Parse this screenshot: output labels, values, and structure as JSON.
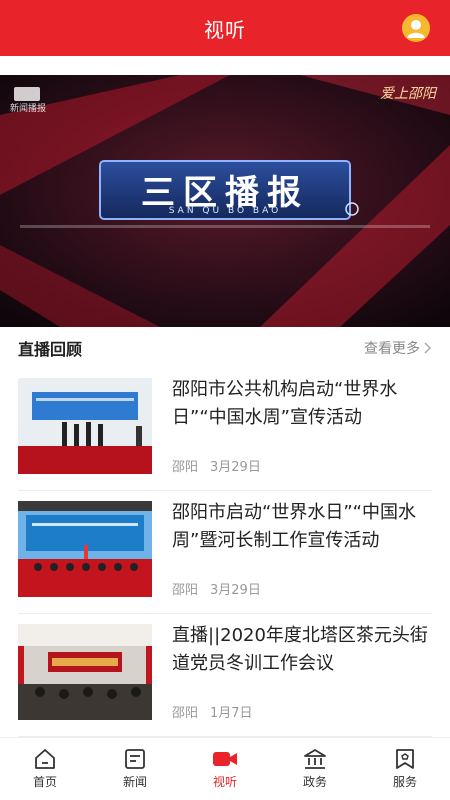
{
  "header": {
    "title": "视听"
  },
  "hero": {
    "title": "三区播报",
    "subtitle": "SAN QU BO BAO",
    "brand_right": "爱上邵阳",
    "brand_left": "新闻播报"
  },
  "section": {
    "title": "直播回顾",
    "more": "查看更多"
  },
  "items": [
    {
      "title": "邵阳市公共机构启动“世界水日”“中国水周”宣传活动",
      "source": "邵阳",
      "date": "3月29日"
    },
    {
      "title": "邵阳市启动“世界水日”“中国水周”暨河长制工作宣传活动",
      "source": "邵阳",
      "date": "3月29日"
    },
    {
      "title": "直播||2020年度北塔区茶元头街道党员冬训工作会议",
      "source": "邵阳",
      "date": "1月7日"
    }
  ],
  "tabs": [
    {
      "label": "首页",
      "icon": "home-icon"
    },
    {
      "label": "新闻",
      "icon": "news-icon"
    },
    {
      "label": "视听",
      "icon": "video-camera-icon",
      "active": true
    },
    {
      "label": "政务",
      "icon": "government-icon"
    },
    {
      "label": "服务",
      "icon": "service-icon"
    }
  ],
  "colors": {
    "brand": "#e8242a",
    "avatar": "#f7b731"
  }
}
